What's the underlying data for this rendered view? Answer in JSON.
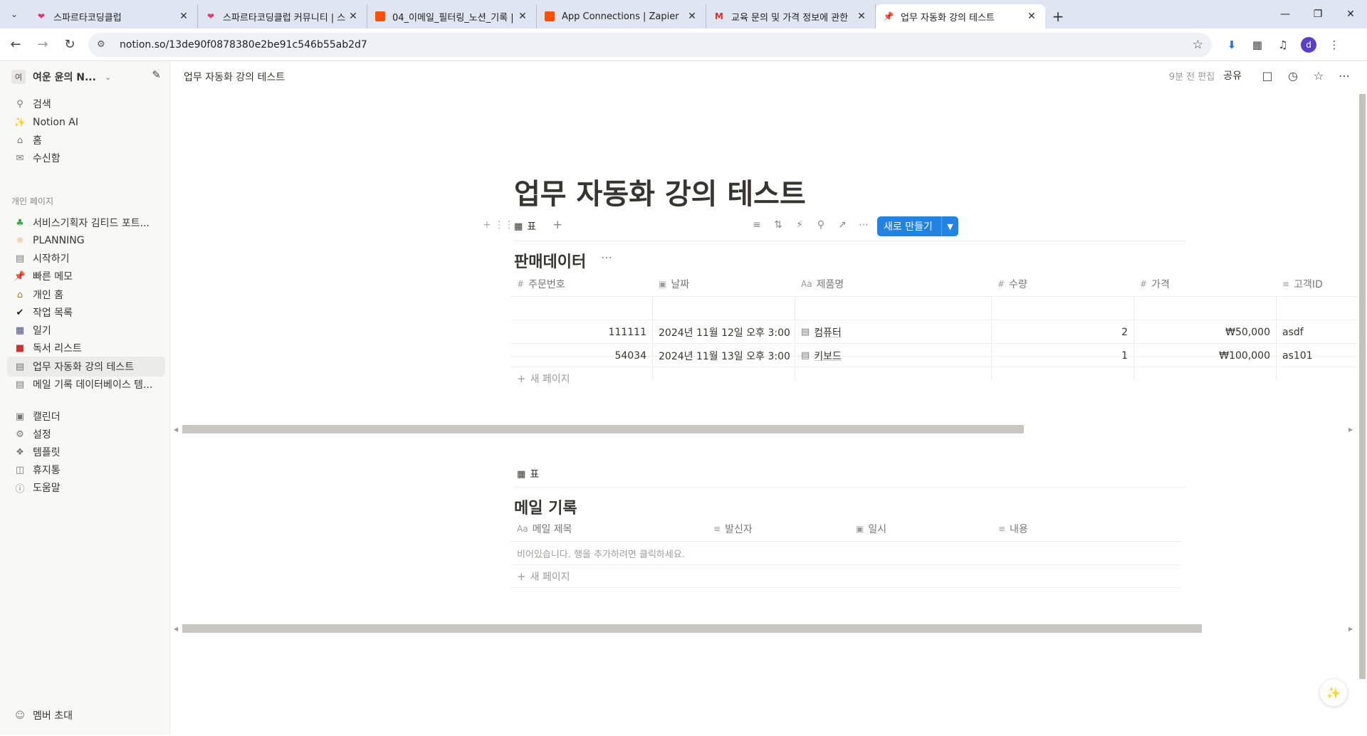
{
  "browser": {
    "tabs": [
      {
        "title": "스파르타코딩클럽",
        "favicon": "heart-icon",
        "color": "#e8336f"
      },
      {
        "title": "스파르타코딩클럽 커뮤니티 | 스",
        "favicon": "heart-icon",
        "color": "#e8336f"
      },
      {
        "title": "04_이메일_필터링_노션_기록 |",
        "favicon": "zapier-icon",
        "color": "#ff4f00"
      },
      {
        "title": "App Connections | Zapier",
        "favicon": "zapier-icon",
        "color": "#ff4f00"
      },
      {
        "title": "교육 문의 및 가격 정보에 관한",
        "favicon": "gmail-icon",
        "color": "#d93025"
      },
      {
        "title": "업무 자동화 강의 테스트",
        "favicon": "pin-icon",
        "color": "#e03e3e"
      }
    ],
    "url": "notion.so/13de90f0878380e2be91c546b55ab2d7",
    "profile_initial": "d"
  },
  "sidebar": {
    "workspace_avatar": "여",
    "workspace_name": "여운 윤의 N...",
    "top_items": [
      {
        "label": "검색",
        "icon": "search-icon"
      },
      {
        "label": "Notion AI",
        "icon": "ai-icon"
      },
      {
        "label": "홈",
        "icon": "home-icon"
      },
      {
        "label": "수신함",
        "icon": "inbox-icon"
      }
    ],
    "section_label": "개인 페이지",
    "pages": [
      {
        "label": "서비스기획자 김티드 포트...",
        "icon": "clover-icon"
      },
      {
        "label": "PLANNING",
        "icon": "sun-icon"
      },
      {
        "label": "시작하기",
        "icon": "page-icon"
      },
      {
        "label": "빠른 메모",
        "icon": "pin-icon"
      },
      {
        "label": "개인 홈",
        "icon": "house-emoji-icon"
      },
      {
        "label": "작업 목록",
        "icon": "check-icon"
      },
      {
        "label": "일기",
        "icon": "notebook-icon"
      },
      {
        "label": "독서 리스트",
        "icon": "book-icon"
      },
      {
        "label": "업무 자동화 강의 테스트",
        "icon": "page-icon"
      },
      {
        "label": "메일 기록 데이터베이스 템...",
        "icon": "page-icon"
      }
    ],
    "bottom_items": [
      {
        "label": "캘린더",
        "icon": "calendar-icon"
      },
      {
        "label": "설정",
        "icon": "gear-icon"
      },
      {
        "label": "템플릿",
        "icon": "template-icon"
      },
      {
        "label": "휴지통",
        "icon": "trash-icon"
      },
      {
        "label": "도움말",
        "icon": "help-icon"
      }
    ],
    "invite_label": "멤버 초대"
  },
  "main": {
    "breadcrumb": "업무 자동화 강의 테스트",
    "edited": "9분 전 편집",
    "share": "공유",
    "title": "업무 자동화 강의 테스트",
    "view_label": "표",
    "new_button": "새로 만들기",
    "db1": {
      "title": "판매데이터",
      "columns": [
        {
          "label": "주문번호",
          "icon": "#"
        },
        {
          "label": "날짜",
          "icon": "calendar"
        },
        {
          "label": "제품명",
          "icon": "Aa"
        },
        {
          "label": "수량",
          "icon": "#"
        },
        {
          "label": "가격",
          "icon": "#"
        },
        {
          "label": "고객ID",
          "icon": "text"
        }
      ],
      "rows": [
        [
          "111111",
          "2024년 11월 12일 오후 3:00",
          "컴퓨터",
          "2",
          "₩50,000",
          "asdf"
        ],
        [
          "54034",
          "2024년 11월 13일 오후 3:00",
          "키보드",
          "1",
          "₩100,000",
          "as101"
        ]
      ],
      "new_page": "새 페이지"
    },
    "db2": {
      "view_label": "표",
      "title": "메일 기록",
      "columns": [
        {
          "label": "메일 제목",
          "icon": "Aa"
        },
        {
          "label": "발신자",
          "icon": "text"
        },
        {
          "label": "일시",
          "icon": "calendar"
        },
        {
          "label": "내용",
          "icon": "text"
        }
      ],
      "empty_text": "비어있습니다. 행을 추가하려면 클릭하세요.",
      "new_page": "새 페이지"
    }
  }
}
